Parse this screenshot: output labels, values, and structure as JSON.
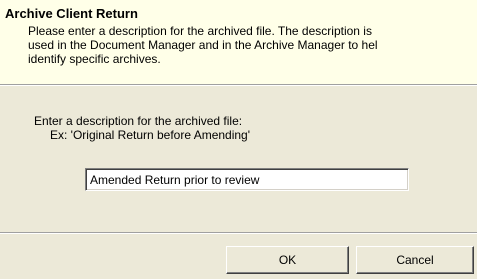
{
  "dialog": {
    "title": "Archive Client Return",
    "description_lines": [
      "Please enter a description for the archived file. The description is",
      "used in the Document Manager and in the Archive Manager to hel",
      "identify specific archives."
    ]
  },
  "form": {
    "prompt": "Enter a description for the archived file:",
    "example": "Ex: 'Original Return before Amending'",
    "description_value": "Amended Return prior to review"
  },
  "buttons": {
    "ok_label": "OK",
    "cancel_label": "Cancel"
  },
  "colors": {
    "header_background": "#ffffe8",
    "dialog_background": "#ece9d8"
  }
}
